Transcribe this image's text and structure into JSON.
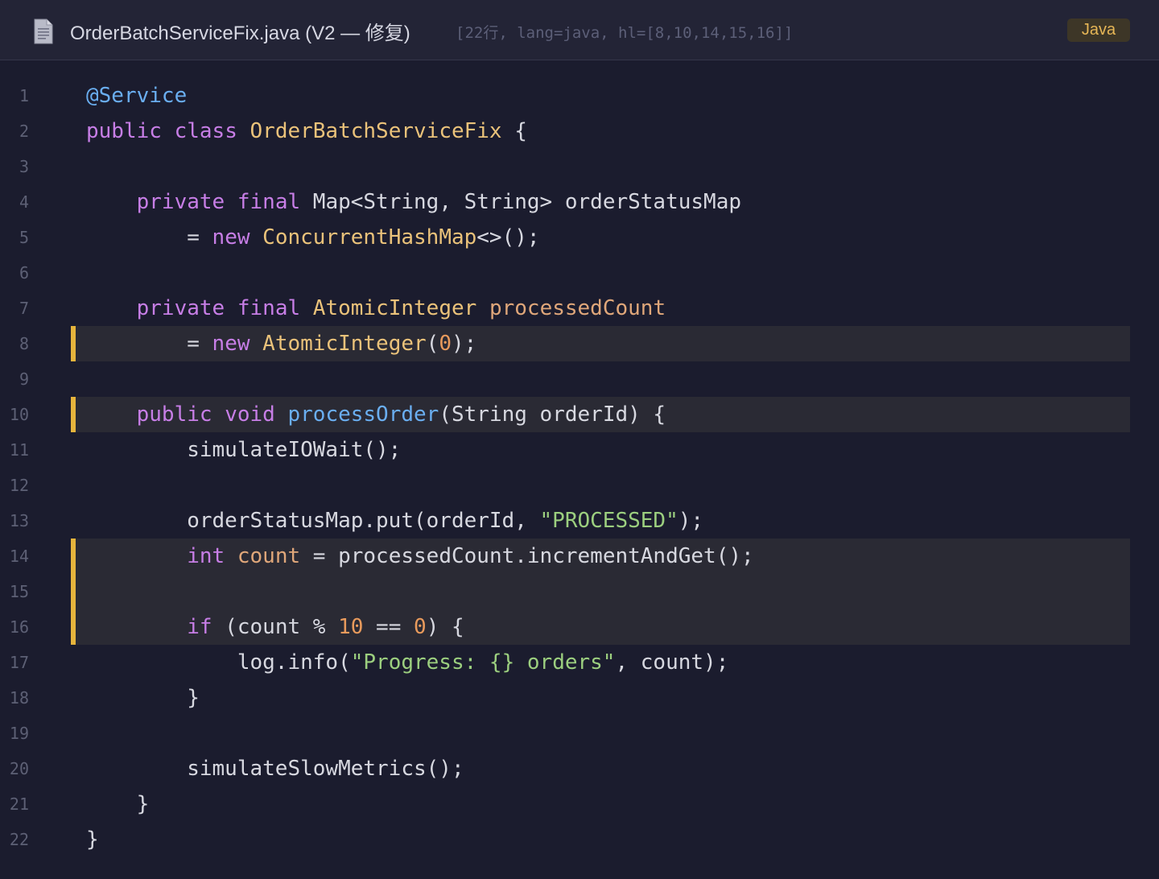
{
  "header": {
    "file_icon": "document-icon",
    "title": "OrderBatchServiceFix.java (V2 — 修复)",
    "meta": "[22行, lang=java, hl=[8,10,14,15,16]]",
    "language_badge": "Java"
  },
  "colors": {
    "background": "#1b1c2e",
    "highlight_bar": "#e6b43c",
    "keyword": "#c77ee6",
    "function": "#6aaef0",
    "type": "#eac27a",
    "string": "#9ccf7f",
    "number": "#e89a5c"
  },
  "code": {
    "highlighted_lines": [
      8,
      10,
      14,
      15,
      16
    ],
    "lines": [
      {
        "n": "1",
        "tokens": [
          {
            "t": "@Service",
            "k": "an"
          }
        ]
      },
      {
        "n": "2",
        "tokens": [
          {
            "t": "public",
            "k": "kw"
          },
          {
            "t": " ",
            "k": "pl"
          },
          {
            "t": "class",
            "k": "kw"
          },
          {
            "t": " ",
            "k": "pl"
          },
          {
            "t": "OrderBatchServiceFix",
            "k": "ty"
          },
          {
            "t": " {",
            "k": "pl"
          }
        ]
      },
      {
        "n": "3",
        "tokens": []
      },
      {
        "n": "4",
        "tokens": [
          {
            "t": "    ",
            "k": "pl"
          },
          {
            "t": "private",
            "k": "kw"
          },
          {
            "t": " ",
            "k": "pl"
          },
          {
            "t": "final",
            "k": "kw"
          },
          {
            "t": " Map<String, String> orderStatusMap",
            "k": "pl"
          }
        ]
      },
      {
        "n": "5",
        "tokens": [
          {
            "t": "        = ",
            "k": "pl"
          },
          {
            "t": "new",
            "k": "kw"
          },
          {
            "t": " ",
            "k": "pl"
          },
          {
            "t": "ConcurrentHashMap",
            "k": "ty"
          },
          {
            "t": "<>();",
            "k": "pl"
          }
        ]
      },
      {
        "n": "6",
        "tokens": []
      },
      {
        "n": "7",
        "tokens": [
          {
            "t": "    ",
            "k": "pl"
          },
          {
            "t": "private",
            "k": "kw"
          },
          {
            "t": " ",
            "k": "pl"
          },
          {
            "t": "final",
            "k": "kw"
          },
          {
            "t": " ",
            "k": "pl"
          },
          {
            "t": "AtomicInteger",
            "k": "ty"
          },
          {
            "t": " ",
            "k": "pl"
          },
          {
            "t": "processedCount",
            "k": "var"
          }
        ]
      },
      {
        "n": "8",
        "tokens": [
          {
            "t": "        = ",
            "k": "pl"
          },
          {
            "t": "new",
            "k": "kw"
          },
          {
            "t": " ",
            "k": "pl"
          },
          {
            "t": "AtomicInteger",
            "k": "ty"
          },
          {
            "t": "(",
            "k": "pl"
          },
          {
            "t": "0",
            "k": "num"
          },
          {
            "t": ");",
            "k": "pl"
          }
        ]
      },
      {
        "n": "9",
        "tokens": []
      },
      {
        "n": "10",
        "tokens": [
          {
            "t": "    ",
            "k": "pl"
          },
          {
            "t": "public",
            "k": "kw"
          },
          {
            "t": " ",
            "k": "pl"
          },
          {
            "t": "void",
            "k": "kw"
          },
          {
            "t": " ",
            "k": "pl"
          },
          {
            "t": "processOrder",
            "k": "fn"
          },
          {
            "t": "(String orderId) {",
            "k": "pl"
          }
        ]
      },
      {
        "n": "11",
        "tokens": [
          {
            "t": "        simulateIOWait();",
            "k": "pl"
          }
        ]
      },
      {
        "n": "12",
        "tokens": []
      },
      {
        "n": "13",
        "tokens": [
          {
            "t": "        orderStatusMap.put(orderId, ",
            "k": "pl"
          },
          {
            "t": "\"PROCESSED\"",
            "k": "str"
          },
          {
            "t": ");",
            "k": "pl"
          }
        ]
      },
      {
        "n": "14",
        "tokens": [
          {
            "t": "        ",
            "k": "pl"
          },
          {
            "t": "int",
            "k": "kw"
          },
          {
            "t": " ",
            "k": "pl"
          },
          {
            "t": "count",
            "k": "var"
          },
          {
            "t": " = processedCount.incrementAndGet();",
            "k": "pl"
          }
        ]
      },
      {
        "n": "15",
        "tokens": []
      },
      {
        "n": "16",
        "tokens": [
          {
            "t": "        ",
            "k": "pl"
          },
          {
            "t": "if",
            "k": "kw"
          },
          {
            "t": " (count % ",
            "k": "pl"
          },
          {
            "t": "10",
            "k": "num"
          },
          {
            "t": " == ",
            "k": "pl"
          },
          {
            "t": "0",
            "k": "num"
          },
          {
            "t": ") {",
            "k": "pl"
          }
        ]
      },
      {
        "n": "17",
        "tokens": [
          {
            "t": "            log.info(",
            "k": "pl"
          },
          {
            "t": "\"Progress: {} orders\"",
            "k": "str"
          },
          {
            "t": ", count);",
            "k": "pl"
          }
        ]
      },
      {
        "n": "18",
        "tokens": [
          {
            "t": "        }",
            "k": "pl"
          }
        ]
      },
      {
        "n": "19",
        "tokens": []
      },
      {
        "n": "20",
        "tokens": [
          {
            "t": "        simulateSlowMetrics();",
            "k": "pl"
          }
        ]
      },
      {
        "n": "21",
        "tokens": [
          {
            "t": "    }",
            "k": "pl"
          }
        ]
      },
      {
        "n": "22",
        "tokens": [
          {
            "t": "}",
            "k": "pl"
          }
        ]
      }
    ]
  }
}
